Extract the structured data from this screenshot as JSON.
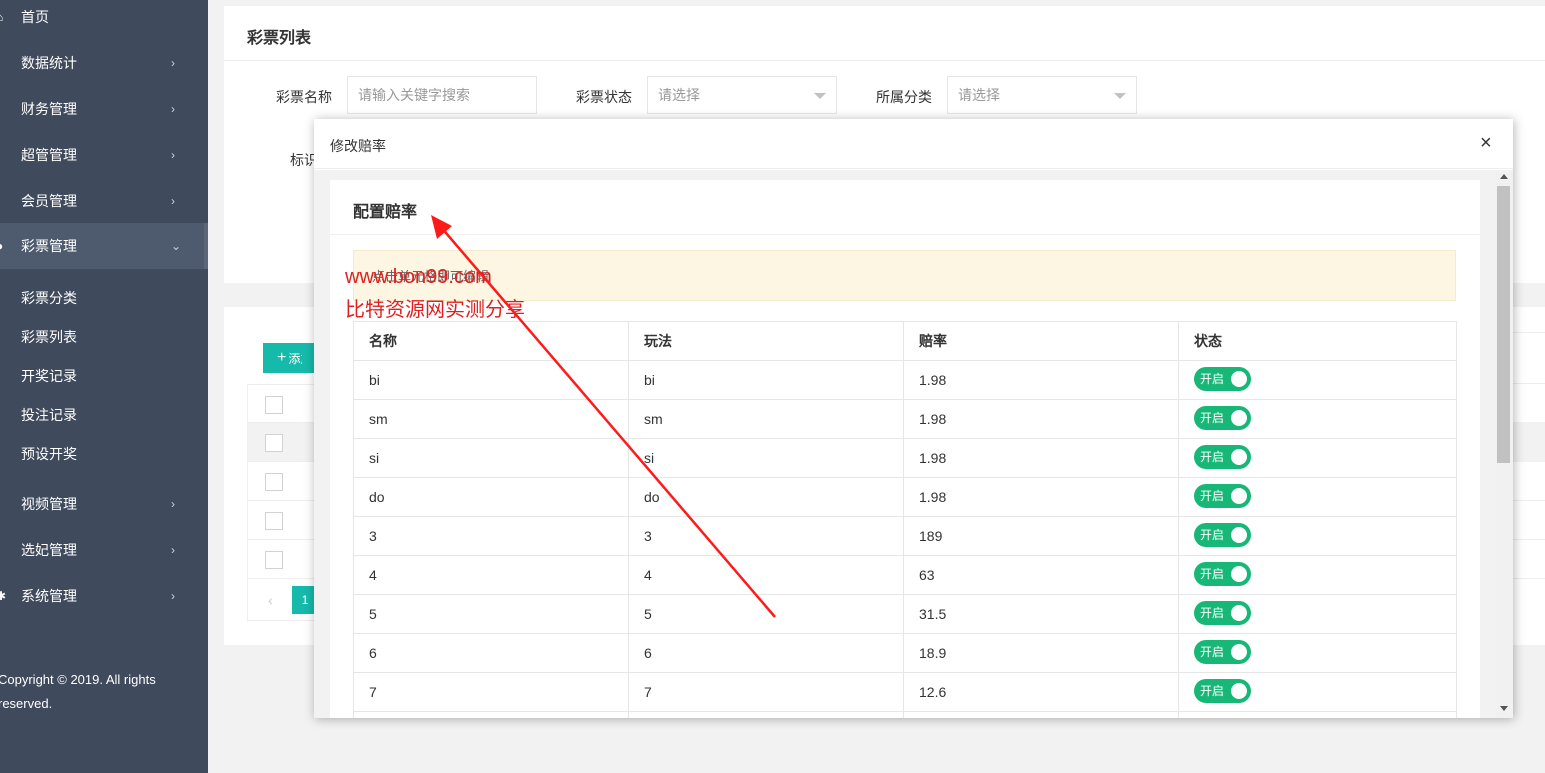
{
  "sidebar": {
    "nav": [
      {
        "label": "首页",
        "icon": "home-icon",
        "arrow": ""
      },
      {
        "label": "数据统计",
        "icon": "chart-icon",
        "arrow": "›"
      },
      {
        "label": "财务管理",
        "icon": "bank-icon",
        "arrow": "›"
      },
      {
        "label": "超管管理",
        "icon": "user-icon",
        "arrow": "›"
      },
      {
        "label": "会员管理",
        "icon": "users-icon",
        "arrow": "›"
      },
      {
        "label": "彩票管理",
        "icon": "lottery-icon",
        "arrow": "⌄"
      },
      {
        "label": "视频管理",
        "icon": "video-icon",
        "arrow": "›"
      },
      {
        "label": "选妃管理",
        "icon": "select-icon",
        "arrow": "›"
      },
      {
        "label": "系统管理",
        "icon": "gear-icon",
        "arrow": "›"
      }
    ],
    "sub": [
      "彩票分类",
      "彩票列表",
      "开奖记录",
      "投注记录",
      "预设开奖"
    ],
    "copyright": "Copyright © 2019. All rights reserved."
  },
  "page": {
    "title": "彩票列表",
    "filters": {
      "name_label": "彩票名称",
      "name_placeholder": "请输入关键字搜索",
      "status_label": "彩票状态",
      "status_value": "请选择",
      "category_label": "所属分类",
      "category_value": "请选择",
      "tag_label": "标识"
    },
    "add_button": "添加",
    "pager_current": "1",
    "pager_prev": "‹"
  },
  "modal": {
    "title": "修改赔率",
    "close": "×",
    "card_title": "配置赔率",
    "notice": "点击单元格即可编辑",
    "columns": [
      "名称",
      "玩法",
      "赔率",
      "状态"
    ],
    "rows": [
      {
        "name": "bi",
        "play": "bi",
        "odds": "1.98",
        "status": "开启"
      },
      {
        "name": "sm",
        "play": "sm",
        "odds": "1.98",
        "status": "开启"
      },
      {
        "name": "si",
        "play": "si",
        "odds": "1.98",
        "status": "开启"
      },
      {
        "name": "do",
        "play": "do",
        "odds": "1.98",
        "status": "开启"
      },
      {
        "name": "3",
        "play": "3",
        "odds": "189",
        "status": "开启"
      },
      {
        "name": "4",
        "play": "4",
        "odds": "63",
        "status": "开启"
      },
      {
        "name": "5",
        "play": "5",
        "odds": "31.5",
        "status": "开启"
      },
      {
        "name": "6",
        "play": "6",
        "odds": "18.9",
        "status": "开启"
      },
      {
        "name": "7",
        "play": "7",
        "odds": "12.6",
        "status": "开启"
      }
    ]
  },
  "watermark": {
    "line1": "www.bon99.com",
    "line2": "比特资源网实测分享"
  },
  "colors": {
    "sidebar": "#3f4a5c",
    "accent": "#16baaa",
    "switch_on": "#16b777",
    "watermark": "#e02020"
  }
}
